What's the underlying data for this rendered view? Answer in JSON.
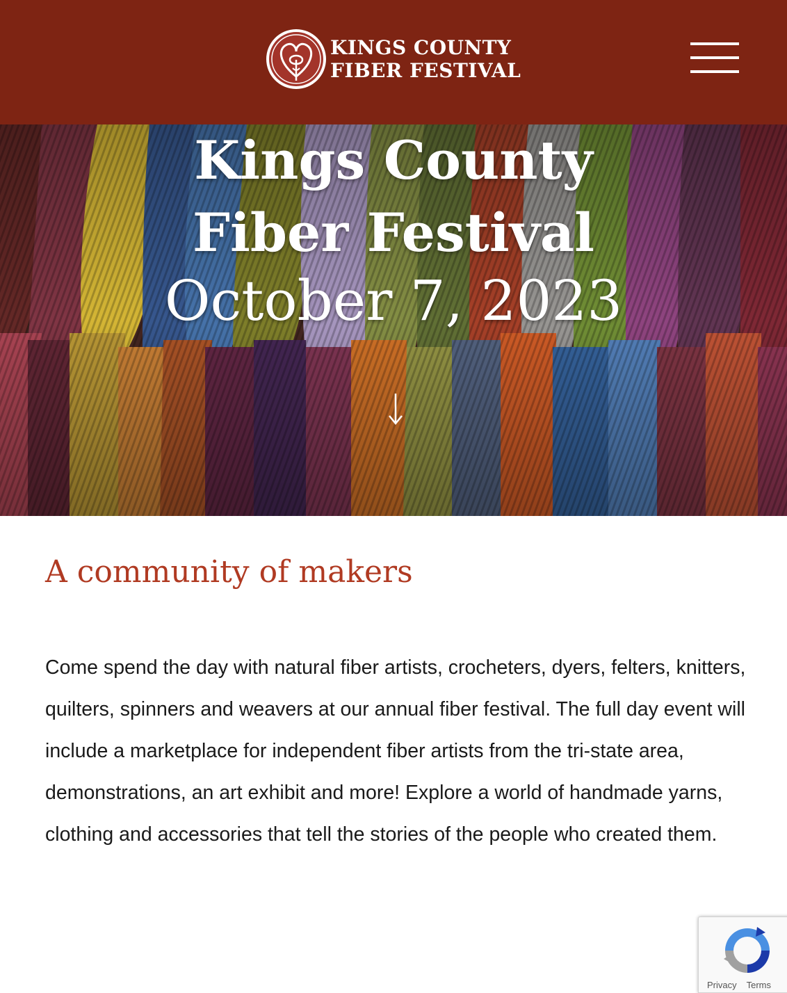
{
  "header": {
    "logo_line1": "KINGS COUNTY",
    "logo_line2": "FIBER FESTIVAL",
    "menu_icon": "hamburger-menu-icon",
    "background_color": "#7e2413"
  },
  "hero": {
    "title": "Kings County Fiber Festival",
    "date": "October 7, 2023",
    "scroll_icon": "arrow-down-icon"
  },
  "content": {
    "heading": "A community of makers",
    "body": "Come spend the day with natural fiber artists, crocheters, dyers, felters, knitters, quilters, spinners and weavers at our annual fiber festival. The full day event will include a marketplace for independent fiber artists from the tri-state area, demonstrations, an art exhibit and more! Explore a world of handmade yarns, clothing and accessories that tell the stories of the people who created them.",
    "heading_color": "#b03a22"
  },
  "recaptcha": {
    "icon": "recaptcha-logo-icon",
    "privacy_label": "Privacy",
    "terms_label": "Terms"
  }
}
